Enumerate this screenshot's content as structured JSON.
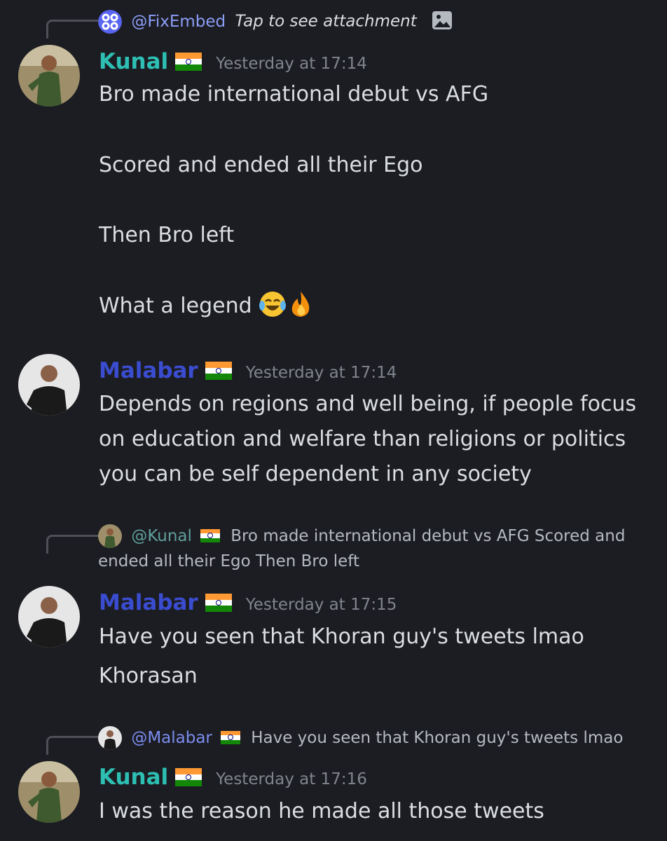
{
  "messages": [
    {
      "reply": {
        "author": "@FixEmbed",
        "text": "Tap to see attachment"
      },
      "author": "Kunal",
      "time": "Yesterday at 17:14",
      "lines": [
        "Bro made international debut vs AFG",
        "Scored and ended all their Ego",
        "Then Bro left",
        "What a legend"
      ]
    },
    {
      "author": "Malabar",
      "time": "Yesterday at 17:14",
      "lines": [
        "Depends on regions and well being, if people focus",
        "on education and welfare than religions or politics",
        "you can be self dependent in any society"
      ]
    },
    {
      "reply": {
        "author": "@Kunal",
        "text_line1": "Bro made international debut vs AFG  Scored and",
        "text_line2": "ended all their Ego   Then Bro left"
      },
      "author": "Malabar",
      "time": "Yesterday at 17:15",
      "lines": [
        "Have you seen that Khoran guy's tweets lmao",
        "Khorasan"
      ]
    },
    {
      "reply": {
        "author": "@Malabar",
        "text": "Have you seen that Khoran guy's tweets lmao"
      },
      "author": "Kunal",
      "time": "Yesterday at 17:16",
      "lines": [
        "I was the reason he made all those tweets"
      ]
    }
  ],
  "colors": {
    "background": "#1c1d22",
    "kunal": "#2dbfb3",
    "malabar": "#3a4ccf",
    "timestamp": "#80848e"
  }
}
